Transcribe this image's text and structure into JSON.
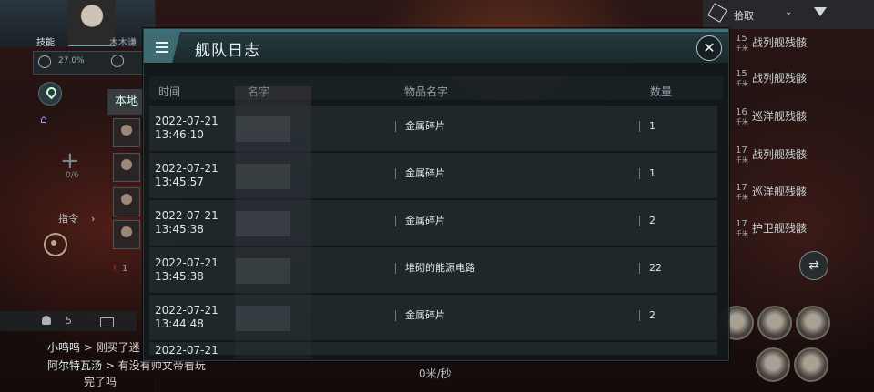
{
  "background": {
    "player_name": "技能",
    "player_corp": "木木谦",
    "stat_percent": "27.0%",
    "local_tab": "本地",
    "member_count": "0/6",
    "command_label": "指令",
    "alert_count": "1",
    "chat_user_count": "5",
    "chat_lines": [
      {
        "name": "小鸣鸣",
        "text": " > 刚买了迷"
      },
      {
        "name": "阿尔特瓦汤",
        "text": " > 有没有帅文帝看玩"
      },
      {
        "name": "",
        "text": "完了吗"
      }
    ],
    "speed_label": "0米/秒",
    "overview": {
      "pick_label": "拾取",
      "rows": [
        {
          "dist": "15",
          "unit": "千米",
          "name": "战列舰残骸"
        },
        {
          "dist": "15",
          "unit": "千米",
          "name": "战列舰残骸"
        },
        {
          "dist": "16",
          "unit": "千米",
          "name": "巡洋舰残骸"
        },
        {
          "dist": "17",
          "unit": "千米",
          "name": "战列舰残骸"
        },
        {
          "dist": "17",
          "unit": "千米",
          "name": "巡洋舰残骸"
        },
        {
          "dist": "17",
          "unit": "千米",
          "name": "护卫舰残骸"
        }
      ]
    }
  },
  "modal": {
    "title": "舰队日志",
    "columns": {
      "time": "时间",
      "name": "名字",
      "item": "物品名字",
      "qty": "数量"
    },
    "rows": [
      {
        "date": "2022-07-21",
        "time": "13:46:10",
        "item": "金属碎片",
        "qty": "1"
      },
      {
        "date": "2022-07-21",
        "time": "13:45:57",
        "item": "金属碎片",
        "qty": "1"
      },
      {
        "date": "2022-07-21",
        "time": "13:45:38",
        "item": "金属碎片",
        "qty": "2"
      },
      {
        "date": "2022-07-21",
        "time": "13:45:38",
        "item": "堆砌的能源电路",
        "qty": "22"
      },
      {
        "date": "2022-07-21",
        "time": "13:44:48",
        "item": "金属碎片",
        "qty": "2"
      },
      {
        "date": "2022-07-21",
        "time": "",
        "item": "",
        "qty": ""
      }
    ]
  },
  "icons": [
    "menu-icon",
    "close-icon",
    "location-pin-icon",
    "plus-icon",
    "target-icon",
    "user-icon",
    "mail-icon",
    "cube-icon",
    "filter-icon",
    "swap-icon"
  ]
}
